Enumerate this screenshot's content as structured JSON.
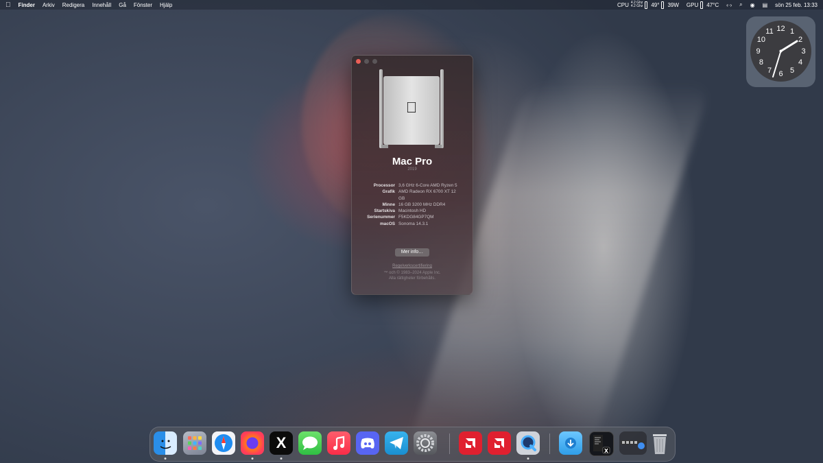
{
  "menubar": {
    "apple_icon": "apple-logo-icon",
    "app_name": "Finder",
    "menus": [
      "Arkiv",
      "Redigera",
      "Innehåll",
      "Gå",
      "Fönster",
      "Hjälp"
    ],
    "cpu_label": "CPU",
    "cpu_ghz_1": "4.2 Ghz",
    "cpu_ghz_2": "4.2 Ghz",
    "cpu_temp": "49°",
    "cpu_power": "39W",
    "gpu_label": "GPU",
    "gpu_temp": "47°C",
    "code_icon": "‹·›",
    "search_icon": "⌕",
    "record_icon": "◉",
    "control_icon": "▤",
    "datetime": "sön 25 feb. 13:33"
  },
  "clock": {
    "numbers": [
      "12",
      "1",
      "2",
      "3",
      "4",
      "5",
      "6",
      "7",
      "8",
      "9",
      "10",
      "11"
    ]
  },
  "about": {
    "title": "Mac Pro",
    "year": "2019",
    "specs": [
      {
        "key": "Processor",
        "value": "3,6 GHz 6-Core AMD Ryzen 5"
      },
      {
        "key": "Grafik",
        "value": "AMD Radeon RX 6700 XT 12 GB"
      },
      {
        "key": "Minne",
        "value": "16 GB 3200 MHz DDR4"
      },
      {
        "key": "Startskiva",
        "value": "Macintosh HD"
      },
      {
        "key": "Serienummer",
        "value": "F5KDG84GP7QM"
      },
      {
        "key": "macOS",
        "value": "Sonoma 14.3.1"
      }
    ],
    "more_button": "Mer info…",
    "regulatory": "Regelverkscertifiering",
    "legal_1": "™ och © 1983–2024 Apple Inc.",
    "legal_2": "Alla rättigheter förbehålls."
  },
  "dock": {
    "x_glyph": "X"
  }
}
